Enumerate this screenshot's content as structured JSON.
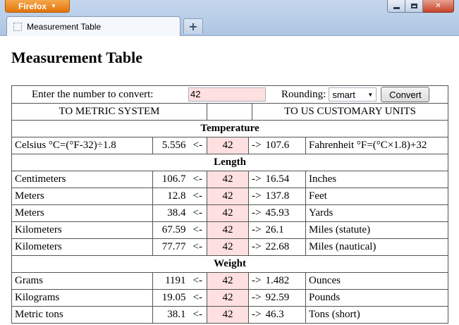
{
  "browser": {
    "menu_button": "Firefox",
    "tab_title": "Measurement Table",
    "new_tab": "+"
  },
  "page": {
    "title": "Measurement Table",
    "input_label": "Enter the number to convert:",
    "input_value": "42",
    "rounding_label": "Rounding:",
    "rounding_value": "smart",
    "convert_button": "Convert",
    "to_metric": "TO METRIC SYSTEM",
    "to_us": "TO US CUSTOMARY UNITS"
  },
  "sections": [
    {
      "name": "Temperature",
      "rows": [
        {
          "left": "Celsius °C=(°F-32)÷1.8",
          "left_val": "5.556",
          "mid": "42",
          "right_val": "107.6",
          "right": "Fahrenheit °F=(°C×1.8)+32"
        }
      ]
    },
    {
      "name": "Length",
      "rows": [
        {
          "left": "Centimeters",
          "left_val": "106.7",
          "mid": "42",
          "right_val": "16.54",
          "right": "Inches"
        },
        {
          "left": "Meters",
          "left_val": "12.8",
          "mid": "42",
          "right_val": "137.8",
          "right": "Feet"
        },
        {
          "left": "Meters",
          "left_val": "38.4",
          "mid": "42",
          "right_val": "45.93",
          "right": "Yards"
        },
        {
          "left": "Kilometers",
          "left_val": "67.59",
          "mid": "42",
          "right_val": "26.1",
          "right": "Miles (statute)"
        },
        {
          "left": "Kilometers",
          "left_val": "77.77",
          "mid": "42",
          "right_val": "22.68",
          "right": "Miles (nautical)"
        }
      ]
    },
    {
      "name": "Weight",
      "rows": [
        {
          "left": "Grams",
          "left_val": "1191",
          "mid": "42",
          "right_val": "1.482",
          "right": "Ounces"
        },
        {
          "left": "Kilograms",
          "left_val": "19.05",
          "mid": "42",
          "right_val": "92.59",
          "right": "Pounds"
        },
        {
          "left": "Metric tons",
          "left_val": "38.1",
          "mid": "42",
          "right_val": "46.3",
          "right": "Tons (short)"
        }
      ]
    }
  ],
  "arrows": {
    "left": "<-",
    "right": "->"
  }
}
